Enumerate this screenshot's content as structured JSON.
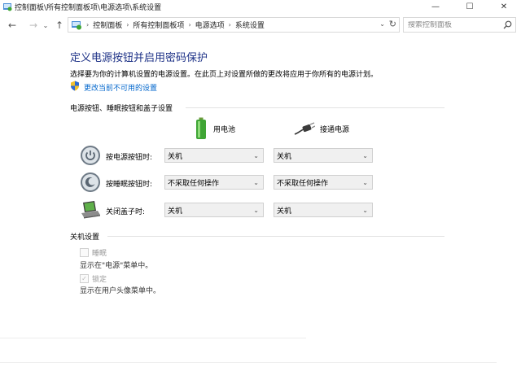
{
  "window": {
    "title": "控制面板\\所有控制面板项\\电源选项\\系统设置",
    "controls": {
      "minimize": "—",
      "maximize": "☐",
      "close": "✕"
    }
  },
  "nav": {
    "back": "←",
    "forward": "→",
    "recent": "⌄",
    "up": "↑",
    "breadcrumbs": [
      "控制面板",
      "所有控制面板项",
      "电源选项",
      "系统设置"
    ],
    "breadcrumb_separator": "›",
    "search_placeholder": "搜索控制面板",
    "refresh": "↻",
    "dropdown": "⌄"
  },
  "page": {
    "title": "定义电源按钮并启用密码保护",
    "description": "选择要为你的计算机设置的电源设置。在此页上对设置所做的更改将应用于你所有的电源计划。",
    "change_link": "更改当前不可用的设置"
  },
  "power_section": {
    "header": "电源按钮、睡眠按钮和盖子设置",
    "columns": {
      "battery": "用电池",
      "plugged": "接通电源"
    },
    "rows": [
      {
        "icon": "power-button-icon",
        "label": "按电源按钮时:",
        "battery": "关机",
        "plugged": "关机"
      },
      {
        "icon": "sleep-button-icon",
        "label": "按睡眠按钮时:",
        "battery": "不采取任何操作",
        "plugged": "不采取任何操作"
      },
      {
        "icon": "laptop-lid-icon",
        "label": "关闭盖子时:",
        "battery": "关机",
        "plugged": "关机"
      }
    ]
  },
  "shutdown_section": {
    "header": "关机设置",
    "items": [
      {
        "label": "睡眠",
        "description": "显示在\"电源\"菜单中。",
        "checked": false
      },
      {
        "label": "锁定",
        "description": "显示在用户头像菜单中。",
        "checked": true
      }
    ]
  },
  "colors": {
    "title_blue": "#1e3287",
    "link_blue": "#0066cc",
    "battery_green": "#3fa535"
  }
}
